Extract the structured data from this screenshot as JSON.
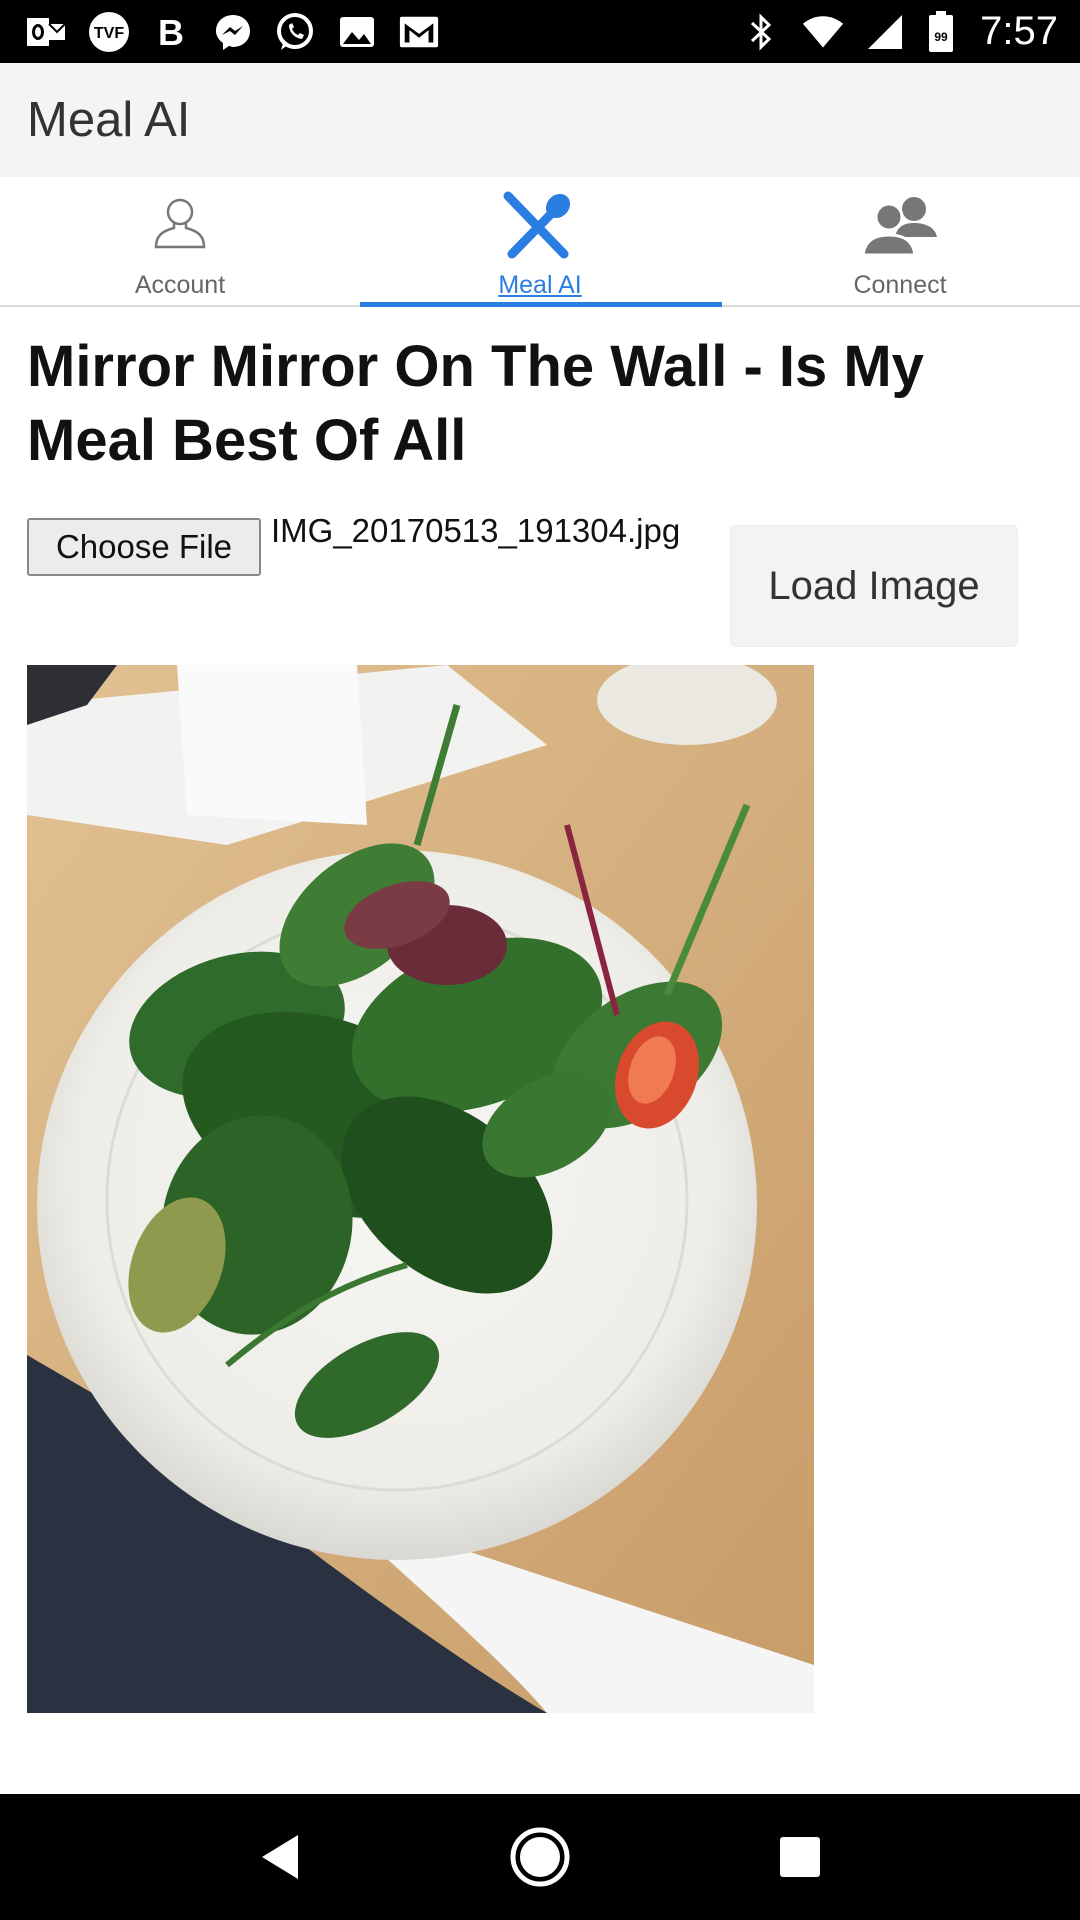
{
  "status_bar": {
    "time": "7:57",
    "battery_level": "99",
    "left_icons": [
      "outlook-icon",
      "tvf-icon",
      "b-icon",
      "messenger-icon",
      "whatsapp-icon",
      "gallery-icon",
      "gmail-icon"
    ],
    "right_icons": [
      "bluetooth-icon",
      "wifi-icon",
      "signal-icon",
      "battery-icon"
    ]
  },
  "app_bar": {
    "title": "Meal AI"
  },
  "tabs": [
    {
      "label": "Account",
      "icon": "person-icon",
      "active": false
    },
    {
      "label": "Meal AI",
      "icon": "fork-spoon-icon",
      "active": true
    },
    {
      "label": "Connect",
      "icon": "people-icon",
      "active": false
    }
  ],
  "content": {
    "headline": "Mirror Mirror On The Wall - Is My Meal Best Of All",
    "choose_file_label": "Choose File",
    "file_name": "IMG_20170513_191304.jpg",
    "load_image_label": "Load Image"
  },
  "nav_bar": {
    "icons": [
      "back-icon",
      "home-icon",
      "recents-icon"
    ]
  },
  "colors": {
    "accent": "#2a7de1",
    "status_bar": "#000000",
    "app_bar": "#f4f4f4"
  }
}
